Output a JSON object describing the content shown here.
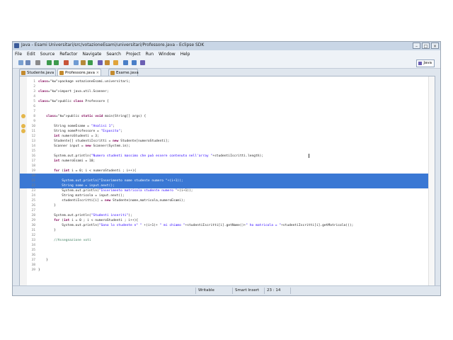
{
  "window": {
    "title": "Java - Esami Universitari/src/votazioneEsami/universitari/Professore.java - Eclipse SDK"
  },
  "menu": [
    "File",
    "Edit",
    "Source",
    "Refactor",
    "Navigate",
    "Search",
    "Project",
    "Run",
    "Window",
    "Help"
  ],
  "toolbar": {
    "perspective_label": "Java",
    "icons": [
      "new-icon",
      "save-icon",
      "print-icon",
      "debug-icon",
      "run-icon",
      "external-tools-icon",
      "new-java-project-icon",
      "new-package-icon",
      "new-class-icon",
      "open-type-icon",
      "search-icon",
      "toggle-mark-icon",
      "back-icon",
      "forward-icon",
      "perspective-icon"
    ]
  },
  "tabs": [
    {
      "label": "Studente.java",
      "active": false
    },
    {
      "label": "Professore.java",
      "active": true
    },
    {
      "label": "Esame.java",
      "active": false
    }
  ],
  "code_lines": [
    {
      "n": "1",
      "text": "package votazioneEsami.universitari;"
    },
    {
      "n": "2",
      "text": ""
    },
    {
      "n": "3",
      "text": "import java.util.Scanner;"
    },
    {
      "n": "4",
      "text": ""
    },
    {
      "n": "5",
      "text": "public class Professore {"
    },
    {
      "n": "6",
      "text": ""
    },
    {
      "n": "7",
      "text": ""
    },
    {
      "n": "8",
      "text": "    public static void main(String[] args) {"
    },
    {
      "n": "9",
      "text": ""
    },
    {
      "n": "10",
      "text": "        String nomeEsame = \"Analisi 1\";"
    },
    {
      "n": "11",
      "text": "        String nomeProfessore = \"Esposito\";"
    },
    {
      "n": "12",
      "text": "        int numeroStudenti = 3;"
    },
    {
      "n": "13",
      "text": "        Studente[] studentiIscritti = new Studente[numeroStudenti];"
    },
    {
      "n": "14",
      "text": "        Scanner input = new Scanner(System.in);"
    },
    {
      "n": "15",
      "text": ""
    },
    {
      "n": "16",
      "text": "        System.out.println(\"Numero studenti massimo che può essere contenuto nell'array \"+studentiIscritti.length);"
    },
    {
      "n": "17",
      "text": "        int numeroEsami = 10;"
    },
    {
      "n": "18",
      "text": ""
    },
    {
      "n": "19",
      "text": "        for (int i = 0; i < numeroStudenti ; i++){"
    },
    {
      "n": "20",
      "text": ""
    },
    {
      "n": "21",
      "text": "            System.out.println(\"Inserimento nome studente numero \"+(i+1));"
    },
    {
      "n": "22",
      "text": "            String nome = input.next();"
    },
    {
      "n": "23",
      "text": "            System.out.println(\"Inserimento matricola studente numero \"+(i+1));"
    },
    {
      "n": "24",
      "text": "            String matricola = input.next();"
    },
    {
      "n": "25",
      "text": "            studentiIscritti[i] = new Studente(nome,matricola,numeroEsami);"
    },
    {
      "n": "26",
      "text": "        }"
    },
    {
      "n": "27",
      "text": ""
    },
    {
      "n": "28",
      "text": "        System.out.println(\"Studenti inseriti\");"
    },
    {
      "n": "29",
      "text": "        for (int i = 0 ; i < numeroStudenti ; i++){"
    },
    {
      "n": "30",
      "text": "            System.out.println(\"Sono lo studente n° \" +(i+1)+ \" mi chiamo \"+studentiIscritti[i].getNome()+\" ho matricola = \"+studentiIscritti[i].getMatricola());"
    },
    {
      "n": "31",
      "text": "        }"
    },
    {
      "n": "32",
      "text": ""
    },
    {
      "n": "33",
      "text": "        //Assegnazione voti"
    },
    {
      "n": "34",
      "text": ""
    },
    {
      "n": "35",
      "text": ""
    },
    {
      "n": "36",
      "text": ""
    },
    {
      "n": "37",
      "text": "    }"
    },
    {
      "n": "38",
      "text": ""
    },
    {
      "n": "39",
      "text": "}"
    }
  ],
  "selection": {
    "first_line": 20,
    "last_line": 22
  },
  "status": {
    "mode": "Writable",
    "insert": "Smart Insert",
    "position": "23 : 14"
  },
  "colors": {
    "selection": "#3a78d4",
    "keyword": "#7f0055",
    "string": "#2a00ff",
    "comment": "#3f7f5f"
  }
}
